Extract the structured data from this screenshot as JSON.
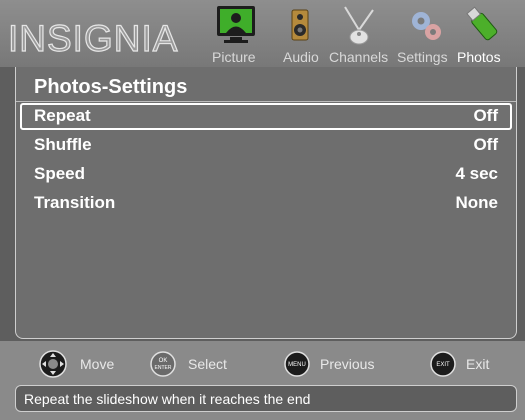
{
  "header": {
    "brand": "INSIGNIA",
    "tabs": [
      {
        "label": "Picture",
        "icon": "tv-picture-icon"
      },
      {
        "label": "Audio",
        "icon": "speaker-icon"
      },
      {
        "label": "Channels",
        "icon": "antenna-icon"
      },
      {
        "label": "Settings",
        "icon": "gears-icon"
      },
      {
        "label": "Photos",
        "icon": "usb-drive-icon",
        "active": true
      }
    ]
  },
  "panel": {
    "title": "Photos-Settings",
    "items": [
      {
        "label": "Repeat",
        "value": "Off",
        "selected": true
      },
      {
        "label": "Shuffle",
        "value": "Off"
      },
      {
        "label": "Speed",
        "value": "4 sec"
      },
      {
        "label": "Transition",
        "value": "None"
      }
    ]
  },
  "help": {
    "hints": [
      {
        "label": "Move",
        "icon": "dpad-icon"
      },
      {
        "label": "Select",
        "icon": "ok-enter-icon",
        "button_text": "OK\nENTER"
      },
      {
        "label": "Previous",
        "icon": "menu-button-icon",
        "button_text": "MENU"
      },
      {
        "label": "Exit",
        "icon": "exit-button-icon",
        "button_text": "EXIT"
      }
    ],
    "status": "Repeat the slideshow when it reaches the end"
  },
  "colors": {
    "background": "#5e5e5e",
    "header": "#8e8e8e",
    "panel": "#6e6e6e",
    "highlight_border": "#ffffff",
    "tv_green": "#3fae2a",
    "usb_green": "#4caf2a"
  }
}
